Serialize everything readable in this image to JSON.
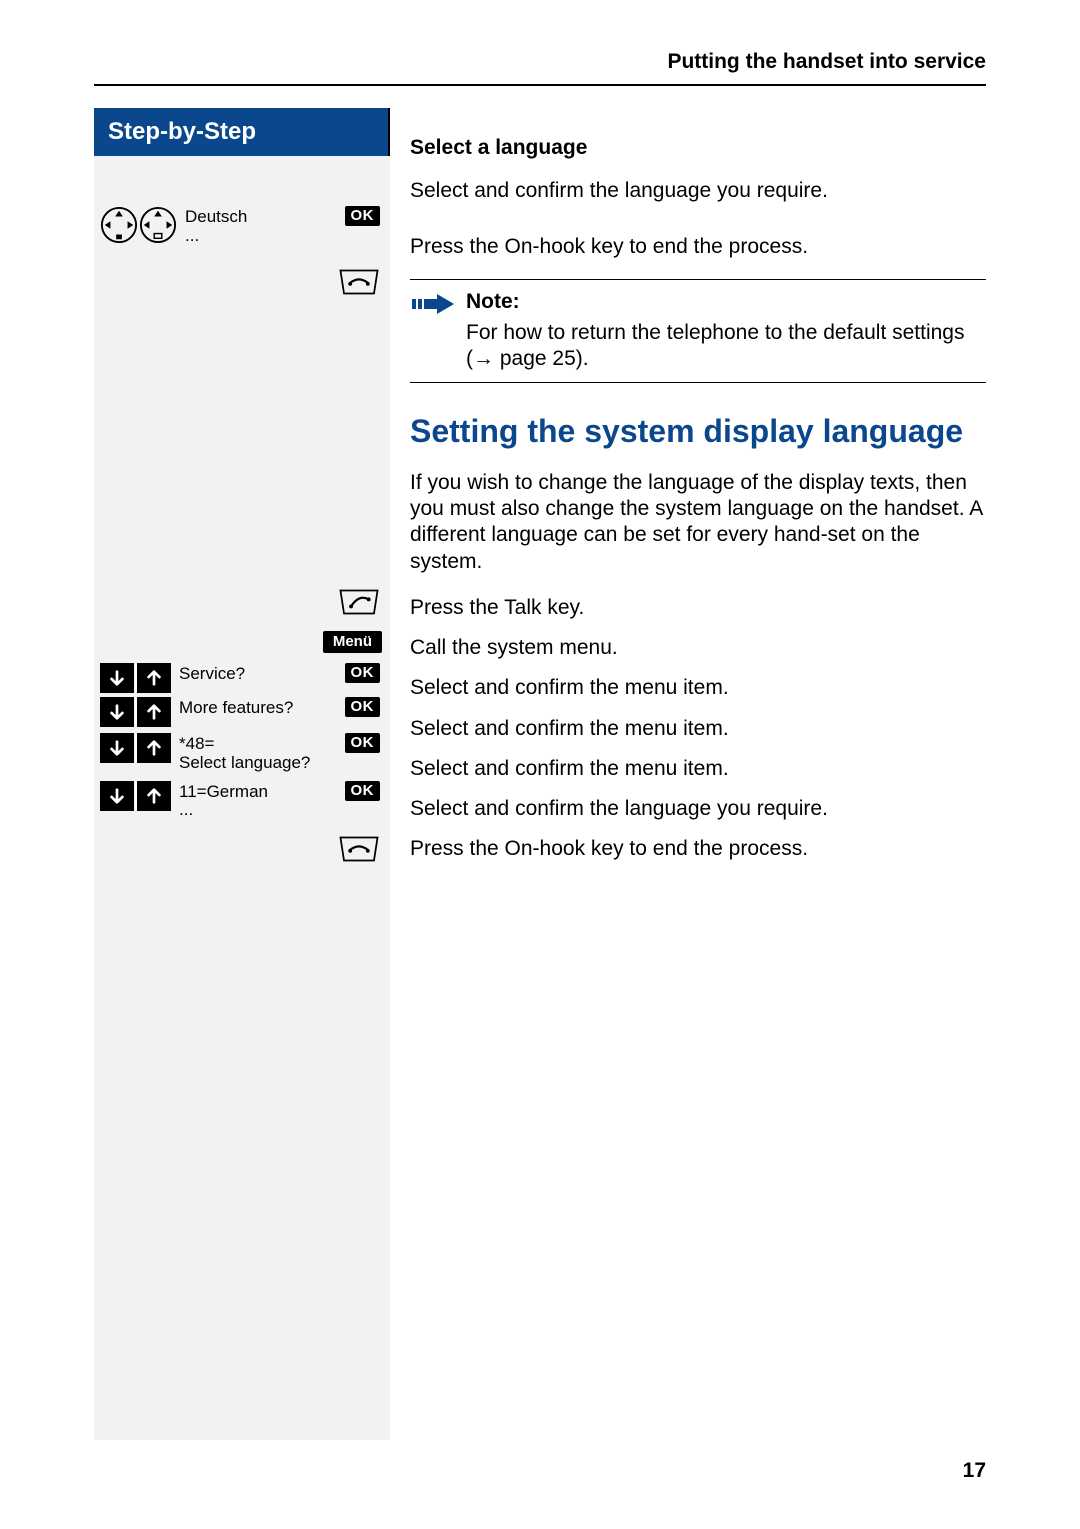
{
  "header": {
    "chapter": "Putting the handset into service"
  },
  "sidebar": {
    "title": "Step-by-Step",
    "ok_label": "OK",
    "menu_label": "Menü",
    "row_language": {
      "label": "Deutsch",
      "sub": "..."
    },
    "row_service": {
      "label": "Service?"
    },
    "row_more_features": {
      "label": "More features?"
    },
    "row_select_lang": {
      "label_line1": "*48=",
      "label_line2": "Select language?"
    },
    "row_german": {
      "label": "11=German",
      "sub": "..."
    }
  },
  "main": {
    "sub_select_language": "Select a language",
    "txt_select_confirm_language": "Select and confirm the language you require.",
    "txt_press_onhook": "Press the On-hook key to end the process.",
    "note_title": "Note:",
    "note_text_a": "For how to return the telephone to the default settings (",
    "note_text_arrow": "→",
    "note_text_b": " page 25).",
    "section_title": "Setting the system display language",
    "intro_para": "If you wish to change the language of the display texts, then you must also change the system language on the handset. A different language can be set for every hand-set on the system.",
    "txt_press_talk": "Press the Talk key.",
    "txt_call_system_menu": "Call the system menu.",
    "txt_select_confirm_item": "Select and confirm the menu item.",
    "txt_select_confirm_language2": "Select and confirm the language you require.",
    "txt_press_onhook2": "Press the On-hook key to end the process."
  },
  "page_number": "17"
}
